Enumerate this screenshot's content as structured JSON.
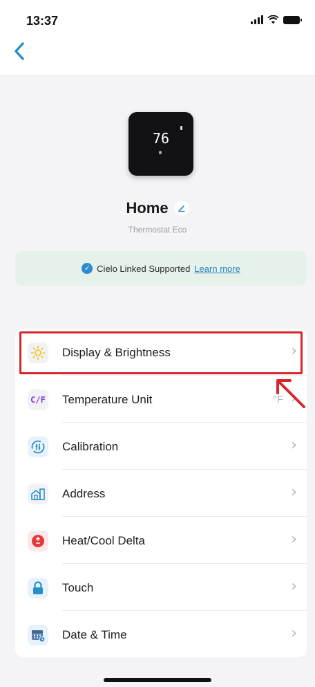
{
  "status_bar": {
    "time": "13:37"
  },
  "header": {
    "back_icon": "chevron-left-icon"
  },
  "device": {
    "display_temp": "76",
    "name": "Home",
    "model": "Thermostat Eco"
  },
  "banner": {
    "text": "Cielo Linked Supported",
    "link": "Learn more"
  },
  "settings": {
    "items": [
      {
        "label": "Display & Brightness",
        "icon": "sun-icon",
        "value": ""
      },
      {
        "label": "Temperature Unit",
        "icon": "cf-unit-icon",
        "icon_text": "C/F",
        "value": "°F"
      },
      {
        "label": "Calibration",
        "icon": "calibration-icon",
        "value": ""
      },
      {
        "label": "Address",
        "icon": "address-icon",
        "value": ""
      },
      {
        "label": "Heat/Cool Delta",
        "icon": "delta-icon",
        "value": ""
      },
      {
        "label": "Touch",
        "icon": "lock-icon",
        "value": ""
      },
      {
        "label": "Date & Time",
        "icon": "calendar-icon",
        "value": ""
      }
    ]
  },
  "colors": {
    "accent": "#2c8ec9",
    "highlight": "#d9262b",
    "banner_bg": "#e4f2ea"
  }
}
